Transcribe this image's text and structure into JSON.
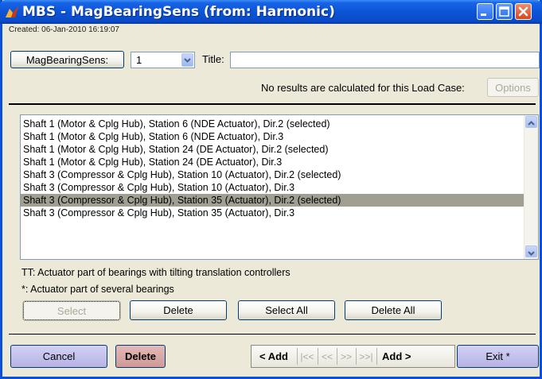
{
  "window": {
    "title": "MBS - MagBearingSens (from: Harmonic)"
  },
  "header": {
    "created": "Created: 06-Jan-2010 16:19:07",
    "type_button_label": "MagBearingSens:",
    "case_select_value": "1",
    "title_label": "Title:",
    "title_value": "",
    "status_text": "No results are calculated for this Load Case:",
    "options_label": "Options"
  },
  "list": {
    "items": [
      "Shaft 1 (Motor & Cplg Hub), Station 6 (NDE Actuator), Dir.2 (selected)",
      "Shaft 1 (Motor & Cplg Hub), Station 6 (NDE Actuator), Dir.3",
      "Shaft 1 (Motor & Cplg Hub), Station 24 (DE Actuator), Dir.2 (selected)",
      "Shaft 1 (Motor & Cplg Hub), Station 24 (DE Actuator), Dir.3",
      "Shaft 3 (Compressor & Cplg Hub), Station 10 (Actuator), Dir.2 (selected)",
      "Shaft 3 (Compressor & Cplg Hub), Station 10 (Actuator), Dir.3",
      "Shaft 3 (Compressor & Cplg Hub), Station 35 (Actuator), Dir.2 (selected)",
      "Shaft 3 (Compressor & Cplg Hub), Station 35 (Actuator), Dir.3"
    ],
    "highlighted_index": 6
  },
  "notes": {
    "tt": "TT: Actuator part of bearings with tilting translation controllers",
    "star": "*: Actuator part of several bearings"
  },
  "list_buttons": {
    "select": "Select",
    "delete": "Delete",
    "select_all": "Select All",
    "delete_all": "Delete All"
  },
  "footer": {
    "cancel": "Cancel",
    "delete": "Delete",
    "add_prev": "< Add",
    "first": "|<<",
    "prev": "<<",
    "next": ">>",
    "last": ">>|",
    "add_next": "Add >",
    "exit": "Exit *"
  },
  "colors": {
    "titlebar": "#0a4bc8",
    "cancel_button": "#c5c3ee",
    "delete_button": "#d9aaa8",
    "exit_button": "#c5c3ee",
    "highlight_row": "#a19e92"
  },
  "icons": [
    "app-icon",
    "minimize-icon",
    "maximize-icon",
    "close-icon",
    "chevron-down-icon",
    "scroll-up-icon",
    "scroll-down-icon"
  ]
}
